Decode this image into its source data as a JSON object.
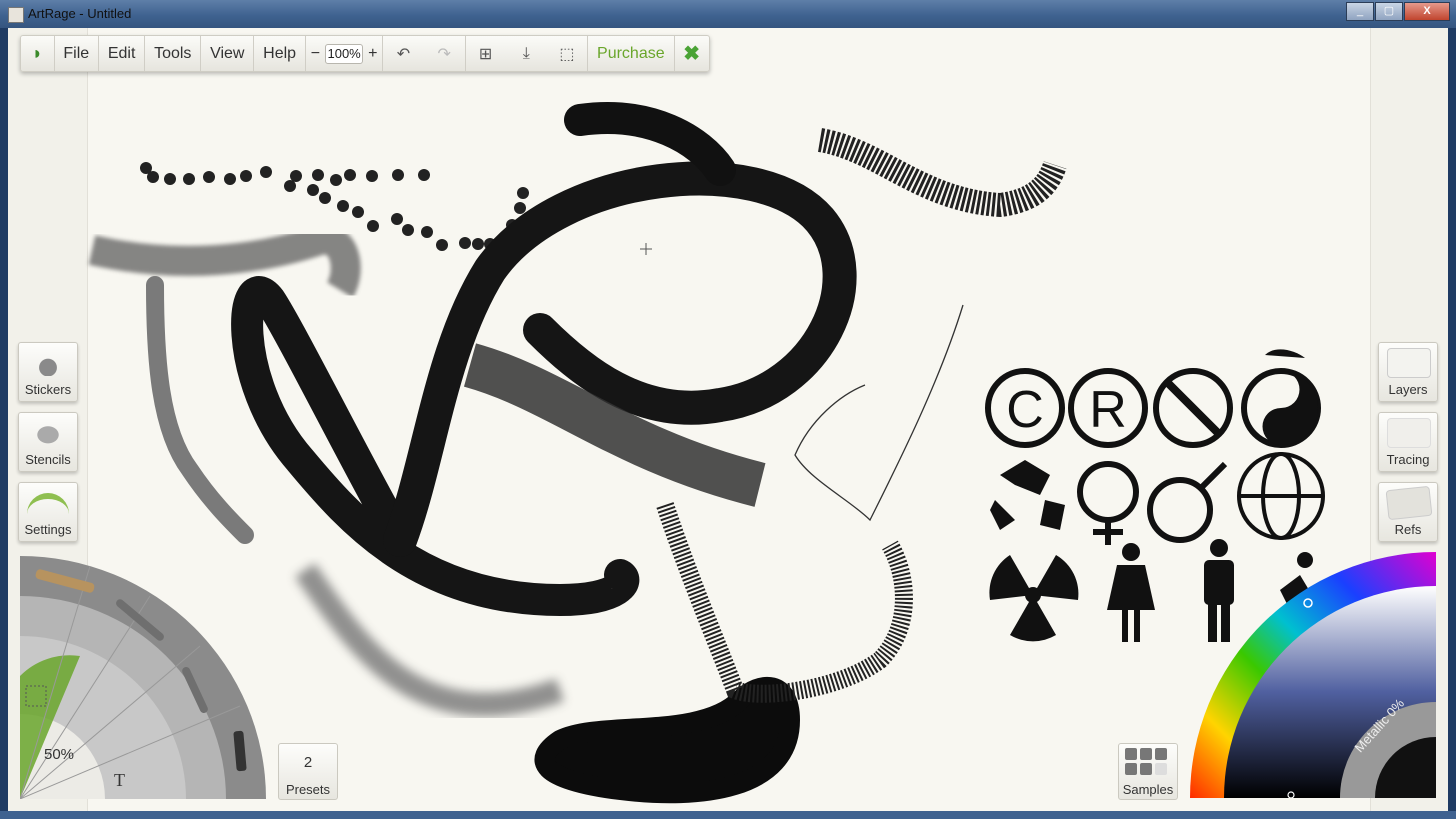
{
  "window": {
    "title": "ArtRage - Untitled",
    "controls": [
      "_",
      "▢",
      "X"
    ]
  },
  "toolbar": {
    "menus": [
      "File",
      "Edit",
      "Tools",
      "View",
      "Help"
    ],
    "zoom_out": "−",
    "zoom_value": "100%",
    "zoom_in": "+",
    "purchase_label": "Purchase",
    "close_label": "✖"
  },
  "left_panel": {
    "stickers_label": "Stickers",
    "stencils_label": "Stencils",
    "settings_label": "Settings"
  },
  "right_panel": {
    "layers_label": "Layers",
    "tracing_label": "Tracing",
    "refs_label": "Refs"
  },
  "presets": {
    "count": "2",
    "label": "Presets"
  },
  "samples": {
    "label": "Samples"
  },
  "tool_wheel": {
    "size_percent": "50%",
    "text_tool": "T"
  },
  "color_picker": {
    "metallic_label": "Metallic 0%",
    "accent": "#6aa62b"
  }
}
